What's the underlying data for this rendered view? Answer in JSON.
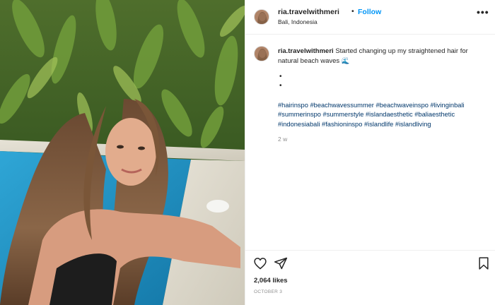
{
  "post": {
    "username": "ria.travelwithmeri",
    "separator": "•",
    "follow_label": "Follow",
    "location": "Bali, Indonesia",
    "more_label": "•••",
    "photo_alt": "Girl with long wavy hair leaning on pool edge in Bali"
  },
  "caption": {
    "username": "ria.travelwithmeri",
    "text": "Started changing up my straightened hair for natural beach waves 🌊",
    "bullet_1": "•",
    "bullet_2": "•",
    "hashtags": "#hairinspo #beachwavessummer #beachwaveinspo #livinginbali #summerinspo #summerstyle #islandaesthetic #baliaesthetic #indonesiabali #fashioninspo #islandlife #islandliving",
    "time_ago": "2 w"
  },
  "stats": {
    "likes": "2,064 likes",
    "date": "OCTOBER 3"
  },
  "icons": {
    "like": "heart-icon",
    "share": "paper-plane-icon",
    "save": "bookmark-icon",
    "more": "ellipsis-icon"
  },
  "colors": {
    "follow": "#0095f6",
    "hashtag": "#00376b",
    "muted": "#8e8e8e",
    "text": "#262626"
  }
}
